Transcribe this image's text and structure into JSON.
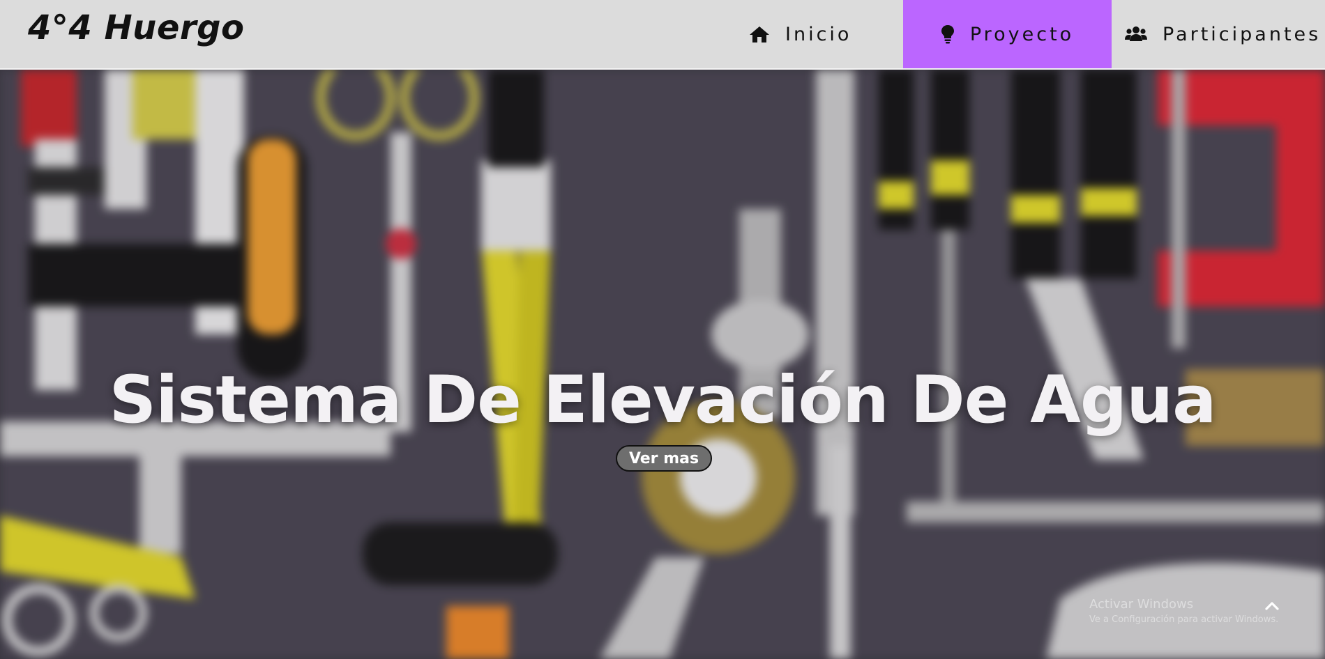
{
  "brand": {
    "logo_text": "4°4 Huergo"
  },
  "nav": {
    "items": [
      {
        "label": "Inicio",
        "icon": "home-icon"
      },
      {
        "label": "Proyecto",
        "icon": "lightbulb-icon",
        "active": true
      },
      {
        "label": "Participantes",
        "icon": "users-icon"
      }
    ]
  },
  "hero": {
    "title": "Sistema De Elevación De Agua",
    "button_label": "Ver mas",
    "background": "blurred-tools-photo"
  },
  "watermark": {
    "title": "Activar Windows",
    "subtitle": "Ve a Configuración para activar Windows."
  },
  "colors": {
    "accent": "#bb66ff",
    "navbar_bg": "#dcdcdc",
    "button_bg": "#6e6e6e"
  },
  "icons": {
    "scroll_top": "chevron-up-icon"
  }
}
